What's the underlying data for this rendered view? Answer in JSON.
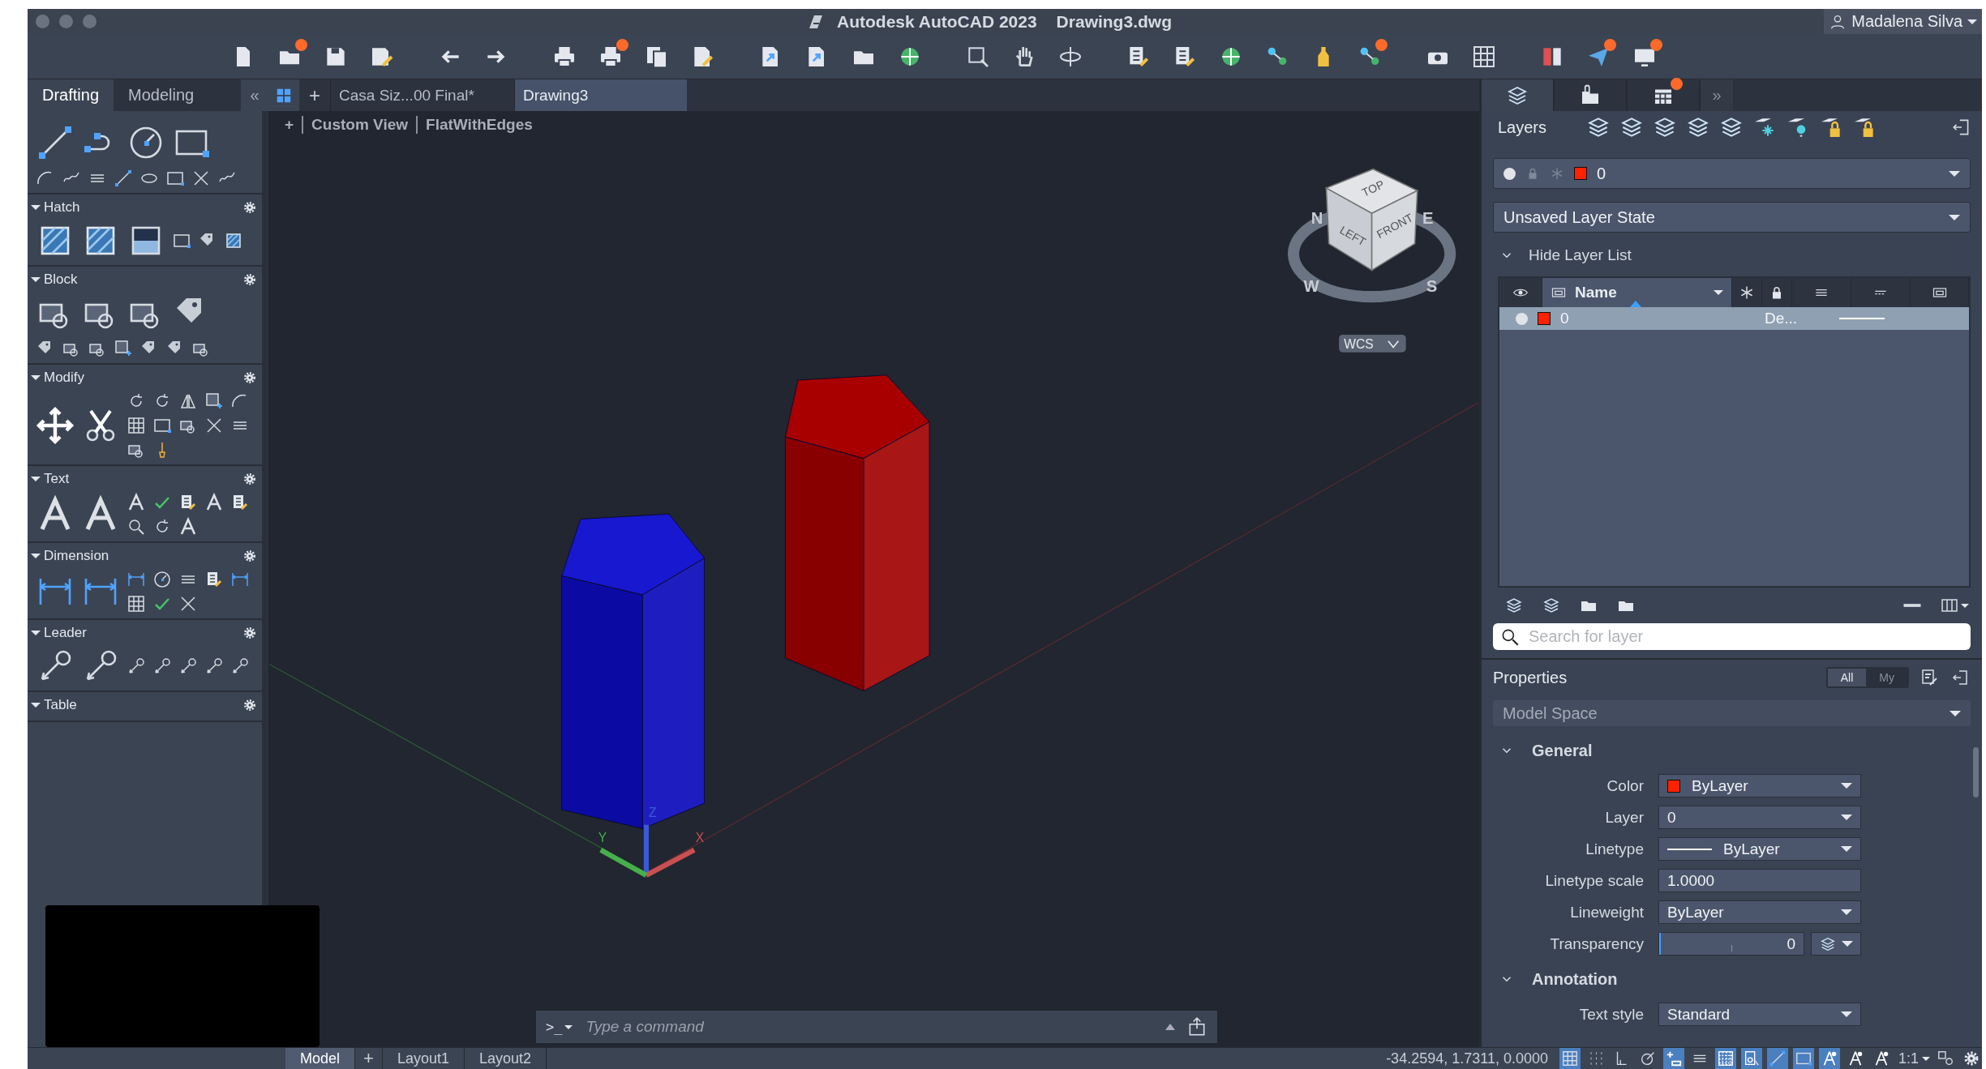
{
  "window": {
    "title": "Autodesk AutoCAD 2023",
    "document": "Drawing3.dwg",
    "user": "Madalena Silva"
  },
  "toolbar": [
    [
      {
        "kind": "page",
        "badge": false
      },
      {
        "kind": "folder",
        "badge": true
      },
      {
        "kind": "floppy",
        "badge": false
      },
      {
        "kind": "floppy-pen",
        "badge": false
      }
    ],
    [
      {
        "kind": "undo",
        "badge": false
      },
      {
        "kind": "redo",
        "badge": false
      }
    ],
    [
      {
        "kind": "printer",
        "badge": false
      },
      {
        "kind": "printer",
        "badge": true
      },
      {
        "kind": "sheets",
        "badge": false
      },
      {
        "kind": "sheet-pen",
        "badge": false
      }
    ],
    [
      {
        "kind": "sheet-arrow",
        "badge": false
      },
      {
        "kind": "sheet-arrow",
        "badge": false
      },
      {
        "kind": "folder",
        "badge": false
      },
      {
        "kind": "globe",
        "badge": false
      }
    ],
    [
      {
        "kind": "magnifier-square",
        "badge": false
      },
      {
        "kind": "hand",
        "badge": false
      },
      {
        "kind": "orbit",
        "badge": false
      }
    ],
    [
      {
        "kind": "list",
        "badge": false
      },
      {
        "kind": "list",
        "badge": false
      },
      {
        "kind": "globe",
        "badge": false
      },
      {
        "kind": "nodes",
        "badge": false
      },
      {
        "kind": "bottle",
        "badge": false
      },
      {
        "kind": "nodes",
        "badge": true
      }
    ],
    [
      {
        "kind": "camera",
        "badge": false
      },
      {
        "kind": "grid",
        "badge": false
      }
    ],
    [
      {
        "kind": "book",
        "badge": false
      },
      {
        "kind": "plane",
        "badge": true
      },
      {
        "kind": "monitor",
        "badge": true
      }
    ]
  ],
  "palette": {
    "tabs": [
      {
        "label": "Drafting",
        "selected": true
      },
      {
        "label": "Modeling",
        "selected": false
      }
    ],
    "collapse": "«",
    "sections": [
      {
        "expanded": true
      },
      {
        "title": "Hatch",
        "expanded": true
      },
      {
        "title": "Block",
        "expanded": true
      },
      {
        "title": "Modify",
        "expanded": true
      },
      {
        "title": "Text",
        "expanded": true
      },
      {
        "title": "Dimension",
        "expanded": true
      },
      {
        "title": "Leader",
        "expanded": true
      },
      {
        "title": "Table",
        "expanded": true
      }
    ]
  },
  "documents": {
    "tabs": [
      {
        "label": "Casa Siz...00 Final*",
        "selected": false
      },
      {
        "label": "Drawing3",
        "selected": true
      }
    ],
    "add": "+"
  },
  "viewport": {
    "controls": [
      "+",
      "Custom View",
      "FlatWithEdges"
    ],
    "viewcube": {
      "faces": [
        "TOP",
        "LEFT",
        "FRONT"
      ],
      "compass": [
        "N",
        "E",
        "W",
        "S"
      ],
      "ucs": "WCS"
    },
    "axes": [
      "X",
      "Y",
      "Z"
    ],
    "command": {
      "prompt": ">_",
      "placeholder": "Type a command"
    }
  },
  "layers": {
    "tabs": [
      {
        "kind": "stack",
        "selected": true,
        "badge": false
      },
      {
        "kind": "clip",
        "selected": false,
        "badge": false
      },
      {
        "kind": "calendar",
        "selected": false,
        "badge": true
      }
    ],
    "expand": "»",
    "title": "Layers",
    "current": {
      "name": "0",
      "color": "#ff2200"
    },
    "state": "Unsaved Layer State",
    "list_toggle": {
      "label": "Hide Layer List",
      "expanded": true
    },
    "columns": [
      {
        "kind": "eye"
      },
      {
        "label": "Name",
        "sorted": true
      },
      {
        "kind": "snowflake"
      },
      {
        "kind": "lock"
      },
      {
        "kind": "lines"
      },
      {
        "kind": "dashes"
      },
      {
        "kind": "plot"
      }
    ],
    "rows": [
      {
        "name": "0",
        "color": "#ff2200",
        "on": true,
        "linetype": "De...",
        "selected": true
      }
    ],
    "search": {
      "placeholder": "Search for layer"
    }
  },
  "properties": {
    "title": "Properties",
    "filter": [
      {
        "label": "All",
        "selected": true
      },
      {
        "label": "My",
        "selected": false
      }
    ],
    "selection": {
      "value": "Model Space",
      "disabled": true
    },
    "sections": [
      {
        "title": "General",
        "expanded": true,
        "rows": [
          {
            "label": "Color",
            "value": "ByLayer",
            "kind": "color",
            "color": "#ff2200"
          },
          {
            "label": "Layer",
            "value": "0",
            "kind": "dropdown"
          },
          {
            "label": "Linetype",
            "value": "ByLayer",
            "kind": "linetype"
          },
          {
            "label": "Linetype scale",
            "value": "1.0000",
            "kind": "text"
          },
          {
            "label": "Lineweight",
            "value": "ByLayer",
            "kind": "dropdown"
          },
          {
            "label": "Transparency",
            "value": "0",
            "kind": "slider",
            "level": 0
          }
        ]
      },
      {
        "title": "Annotation",
        "expanded": true,
        "rows": [
          {
            "label": "Text style",
            "value": "Standard",
            "kind": "dropdown"
          }
        ]
      }
    ]
  },
  "status": {
    "layouts": [
      {
        "label": "Model",
        "selected": true
      },
      {
        "label": "Layout1",
        "selected": false
      },
      {
        "label": "Layout2",
        "selected": false
      }
    ],
    "add": "+",
    "coordinates": "-34.2594, 1.7311, 0.0000",
    "toggles": [
      {
        "kind": "grid",
        "on": true
      },
      {
        "kind": "dots",
        "on": false
      },
      {
        "kind": "ortho",
        "on": false
      },
      {
        "kind": "polar",
        "on": false
      },
      {
        "kind": "snap-plus",
        "on": true
      },
      {
        "kind": "lines",
        "on": false
      },
      {
        "kind": "checker",
        "on": true
      },
      {
        "kind": "select",
        "on": true
      },
      {
        "kind": "line",
        "on": true
      },
      {
        "kind": "rectangle",
        "on": true
      },
      {
        "kind": "person",
        "on": true
      },
      {
        "kind": "person",
        "on": false
      },
      {
        "kind": "person",
        "on": false
      }
    ],
    "scale": "1:1"
  }
}
